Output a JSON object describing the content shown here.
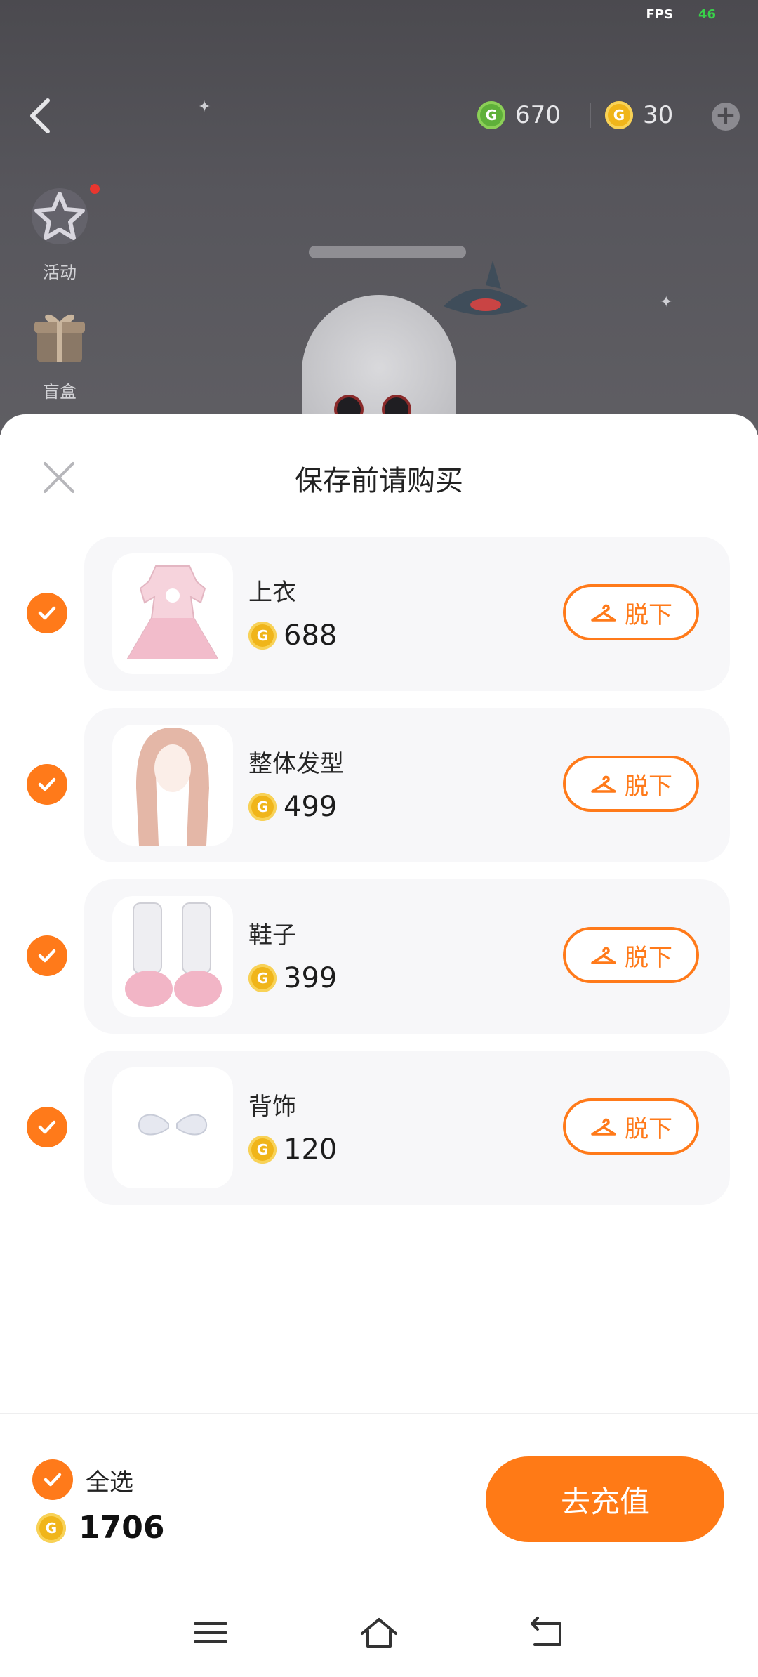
{
  "status": {
    "fps_label": "FPS",
    "fps_value": "46"
  },
  "topbar": {
    "currency_green": {
      "icon": "green-g-coin-icon",
      "value": "670"
    },
    "currency_gold": {
      "icon": "gold-g-coin-icon",
      "value": "30"
    }
  },
  "side": {
    "activity_label": "活动",
    "blindbox_label": "盲盒"
  },
  "sheet": {
    "title": "保存前请购买",
    "items": [
      {
        "name": "上衣",
        "price": "688",
        "action": "脱下",
        "checked": true
      },
      {
        "name": "整体发型",
        "price": "499",
        "action": "脱下",
        "checked": true
      },
      {
        "name": "鞋子",
        "price": "399",
        "action": "脱下",
        "checked": true
      },
      {
        "name": "背饰",
        "price": "120",
        "action": "脱下",
        "checked": true
      }
    ],
    "select_all_label": "全选",
    "total": "1706",
    "recharge_label": "去充值"
  },
  "colors": {
    "accent": "#FF7A16",
    "coin_gold": "#F0B51A",
    "coin_green": "#5FB03A"
  }
}
